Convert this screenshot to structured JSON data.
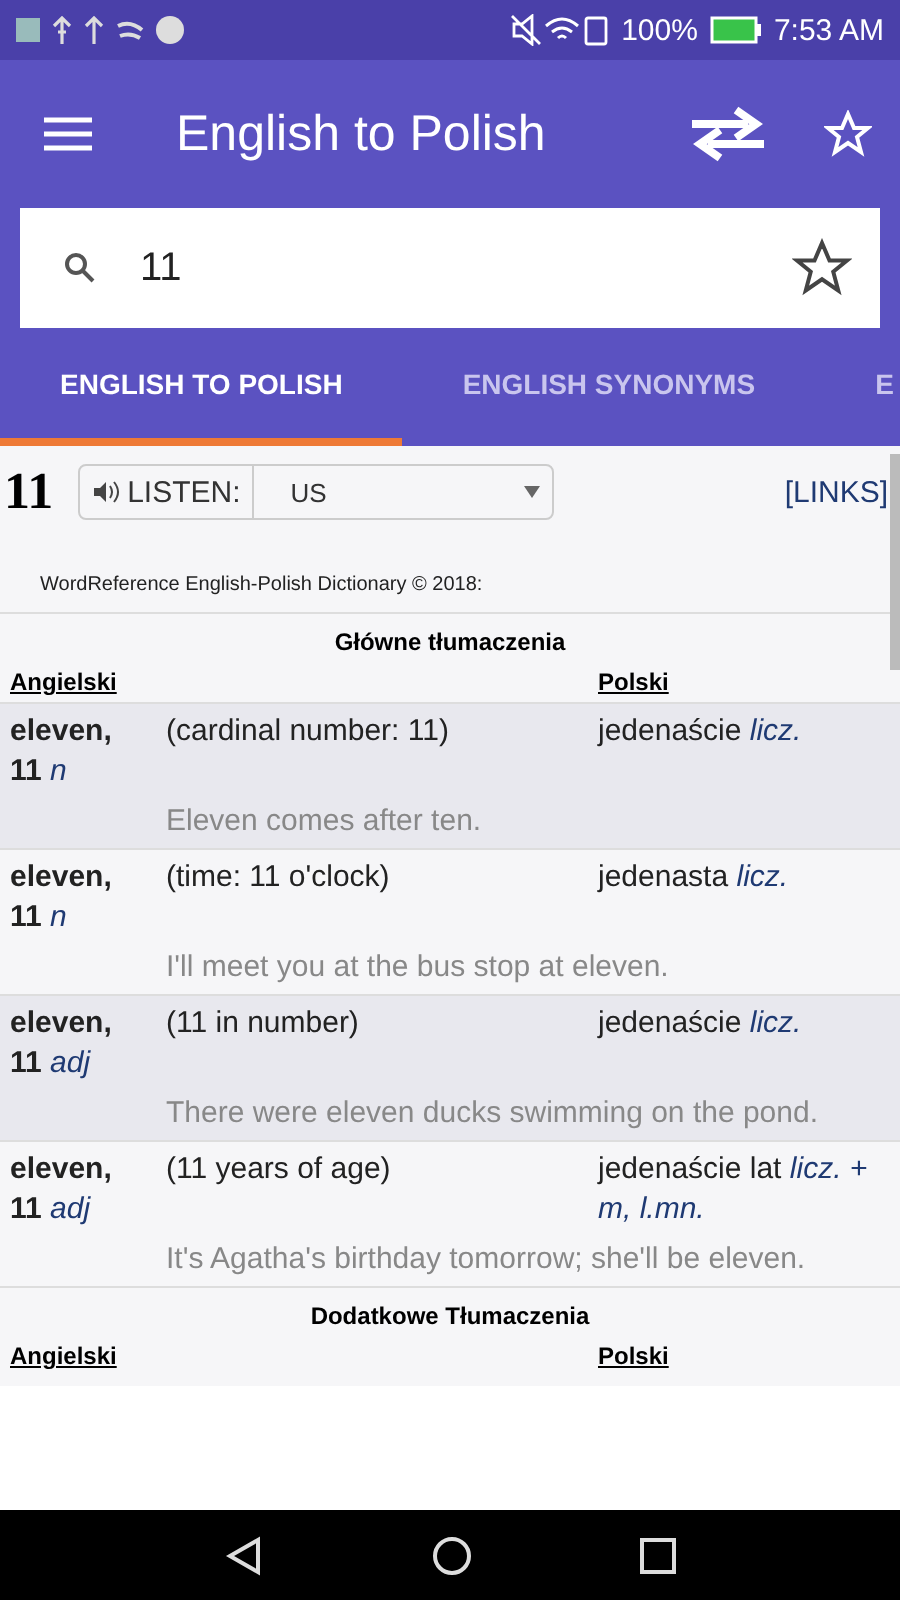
{
  "status_bar": {
    "battery": "100%",
    "time": "7:53 AM"
  },
  "app_bar": {
    "title": "English to Polish"
  },
  "search": {
    "value": "11"
  },
  "tabs": [
    {
      "label": "ENGLISH TO POLISH",
      "selected": true
    },
    {
      "label": "ENGLISH SYNONYMS",
      "selected": false
    },
    {
      "label": "E",
      "selected": false
    }
  ],
  "entry": {
    "headword": "11",
    "listen_label": "LISTEN:",
    "accent": "US",
    "links": "[LINKS]",
    "copyright": "WordReference English-Polish Dictionary © 2018:"
  },
  "sections": [
    {
      "title": "Główne tłumaczenia",
      "column_1": "Angielski",
      "column_2": "Polski",
      "rows": [
        {
          "term": "eleven, 11",
          "pos": "n",
          "definition": "(cardinal number: 11)",
          "translation": "jedenaście",
          "translation_pos": "licz.",
          "example": "Eleven comes after ten."
        },
        {
          "term": "eleven, 11",
          "pos": "n",
          "definition": "(time: 11 o'clock)",
          "translation": "jedenasta",
          "translation_pos": "licz.",
          "example": "I'll meet you at the bus stop at eleven."
        },
        {
          "term": "eleven, 11",
          "pos": "adj",
          "definition": "(11 in number)",
          "translation": "jedenaście",
          "translation_pos": "licz.",
          "example": "There were eleven ducks swimming on the pond."
        },
        {
          "term": "eleven, 11",
          "pos": "adj",
          "definition": "(11 years of age)",
          "translation": "jedenaście lat",
          "translation_pos": "licz. + m, l.mn.",
          "example": "It's Agatha's birthday tomorrow; she'll be eleven."
        }
      ]
    },
    {
      "title": "Dodatkowe Tłumaczenia",
      "column_1": "Angielski",
      "column_2": "Polski"
    }
  ]
}
